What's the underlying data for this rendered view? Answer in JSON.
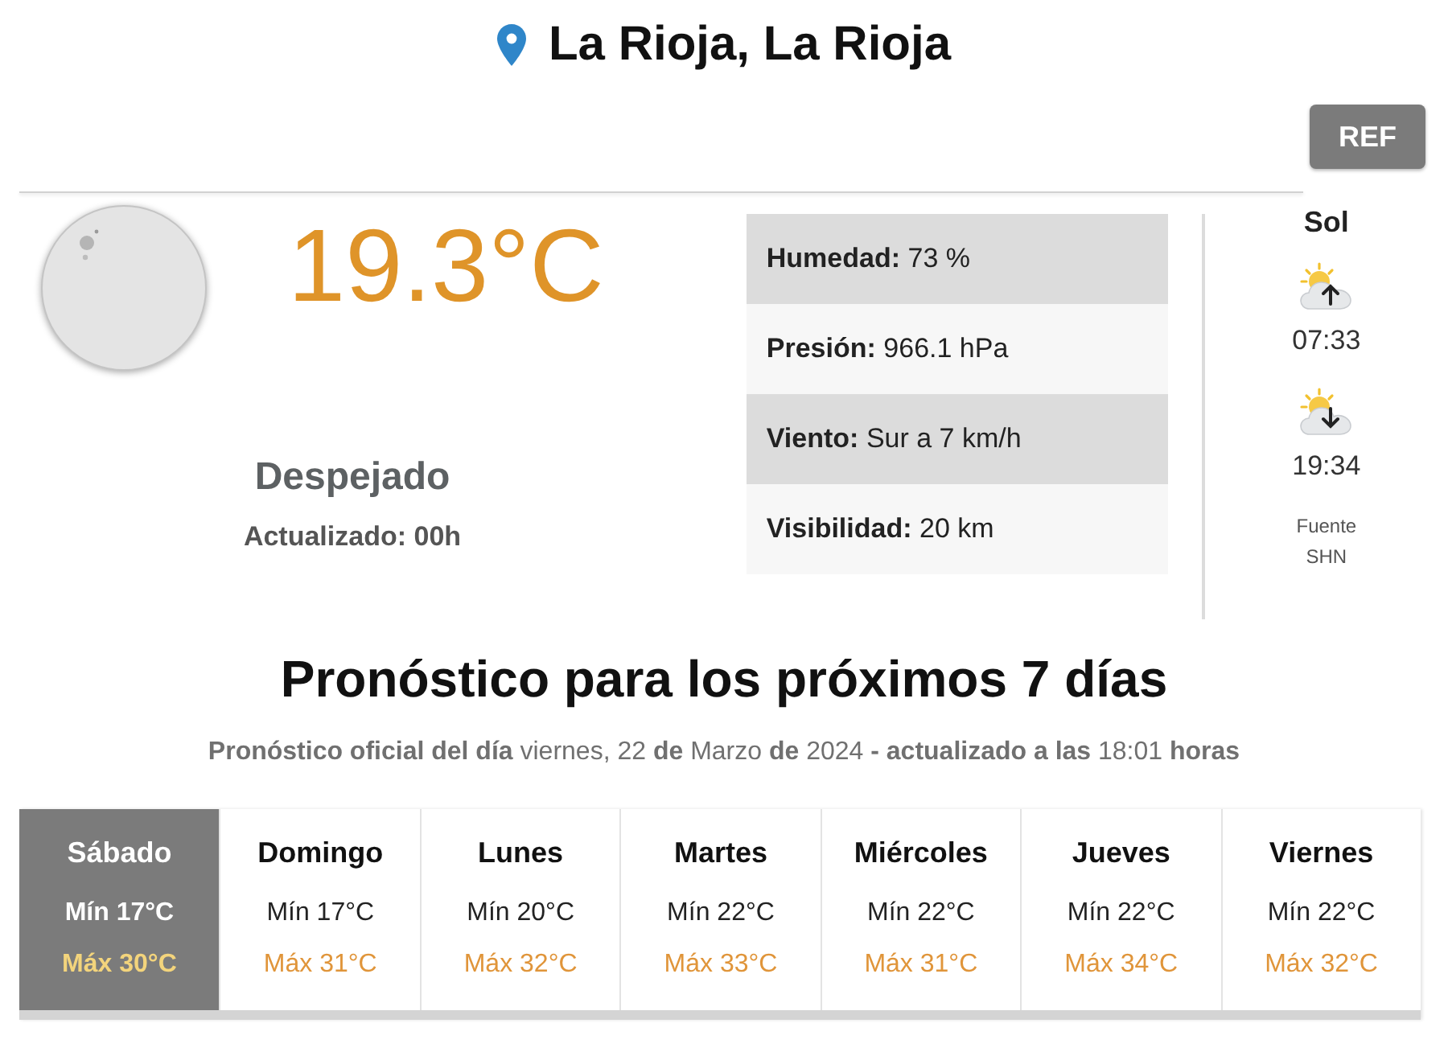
{
  "location": {
    "title": "La Rioja, La Rioja"
  },
  "refresh_button": {
    "label": "REF"
  },
  "current": {
    "temperature": "19.3°C",
    "condition": "Despejado",
    "updated": "Actualizado: 00h"
  },
  "details": [
    {
      "label": "Humedad:",
      "value": "73 %"
    },
    {
      "label": "Presión:",
      "value": "966.1 hPa"
    },
    {
      "label": "Viento:",
      "value": "Sur a 7 km/h"
    },
    {
      "label": "Visibilidad:",
      "value": "20 km"
    }
  ],
  "sun": {
    "title": "Sol",
    "events": [
      {
        "kind": "sunrise",
        "time": "07:33"
      },
      {
        "kind": "sunset",
        "time": "19:34"
      }
    ],
    "source_label": "Fuente",
    "source": "SHN"
  },
  "forecast": {
    "title": "Pronóstico para los próximos 7 días",
    "subtitle": "**Pronóstico oficial del día** viernes, 22 **de** Marzo **de** 2024 **- actualizado a las** 18:01 **horas**",
    "days": [
      {
        "name": "Sábado",
        "min": "Mín 17°C",
        "max": "Máx 30°C",
        "selected": true
      },
      {
        "name": "Domingo",
        "min": "Mín 17°C",
        "max": "Máx 31°C",
        "selected": false
      },
      {
        "name": "Lunes",
        "min": "Mín 20°C",
        "max": "Máx 32°C",
        "selected": false
      },
      {
        "name": "Martes",
        "min": "Mín 22°C",
        "max": "Máx 33°C",
        "selected": false
      },
      {
        "name": "Miércoles",
        "min": "Mín 22°C",
        "max": "Máx 31°C",
        "selected": false
      },
      {
        "name": "Jueves",
        "min": "Mín 22°C",
        "max": "Máx 34°C",
        "selected": false
      },
      {
        "name": "Viernes",
        "min": "Mín 22°C",
        "max": "Máx 32°C",
        "selected": false
      }
    ]
  }
}
